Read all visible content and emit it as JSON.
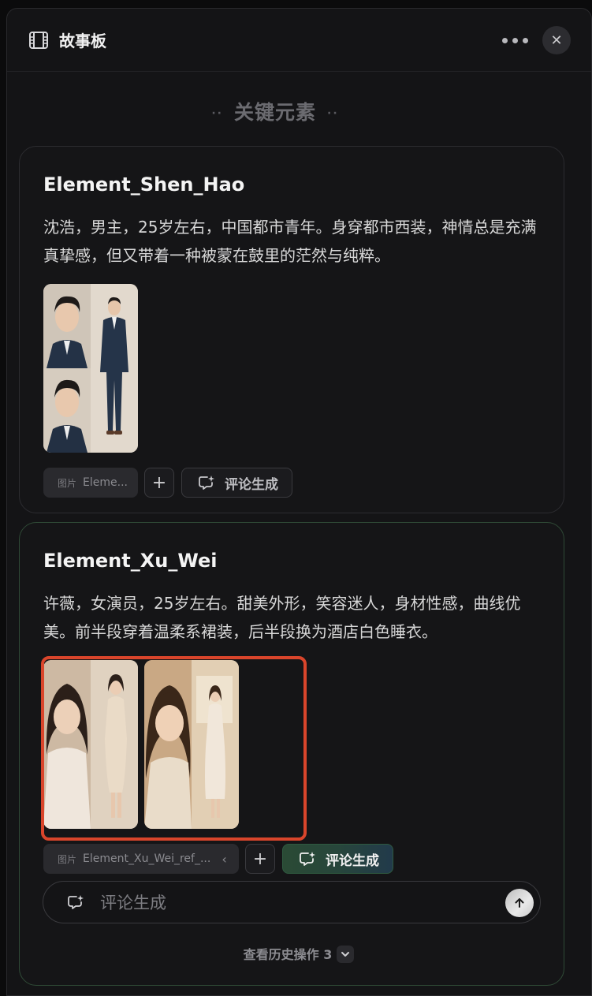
{
  "header": {
    "title": "故事板",
    "icons": {
      "app": "film-strip-icon",
      "more": "more-icon",
      "close": "close-icon"
    }
  },
  "section": {
    "title": "关键元素"
  },
  "elements": [
    {
      "name": "Element_Shen_Hao",
      "description": "沈浩，男主，25岁左右，中国都市青年。身穿都市西装，神情总是充满真挚感，但又带着一种被蒙在鼓里的茫然与纯粹。",
      "images": [
        {
          "alt": "沈浩参考图（正面、半身与全身西装照）"
        }
      ],
      "reference": {
        "tag": "图片",
        "name": "Eleme..."
      },
      "generate_label": "评论生成"
    },
    {
      "name": "Element_Xu_Wei",
      "description": "许薇，女演员，25岁左右。甜美外形，笑容迷人，身材性感，曲线优美。前半段穿着温柔系裙装，后半段换为酒店白色睡衣。",
      "images": [
        {
          "alt": "许薇参考图1（米色贴身连衣裙）"
        },
        {
          "alt": "许薇参考图2（白色长裙于室内）"
        }
      ],
      "reference": {
        "tag": "图片",
        "name": "Element_Xu_Wei_ref_..."
      },
      "generate_label": "评论生成"
    }
  ],
  "comment": {
    "placeholder": "评论生成"
  },
  "history": {
    "label": "查看历史操作 3"
  },
  "colors": {
    "highlight_border": "#d9452b",
    "accent_green": "#2a4a35",
    "background": "#141416"
  }
}
